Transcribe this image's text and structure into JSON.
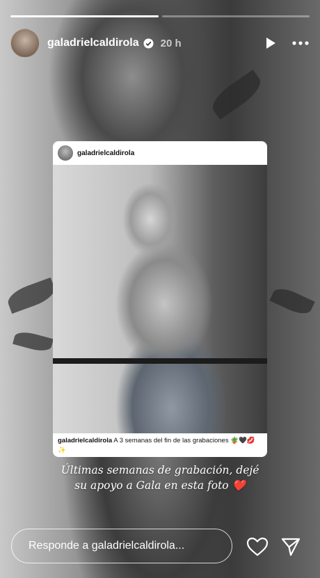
{
  "progress": {
    "segments": 2,
    "active_index": 0
  },
  "header": {
    "username": "galadrielcaldirola",
    "time": "20 h",
    "verified_icon": "verified-badge-icon",
    "play_icon": "play-icon",
    "more_icon": "more-icon"
  },
  "repost": {
    "username": "galadrielcaldirola",
    "caption_user": "galadrielcaldirola",
    "caption_text": "A 3 semanas del fin de las grabaciones 🪴🖤💋✨"
  },
  "story_text": {
    "line1": "Últimas semanas de grabación, dejé",
    "line2": "su apoyo a Gala en esta foto ❤️"
  },
  "footer": {
    "reply_placeholder": "Responde a galadrielcaldirola...",
    "like_icon": "heart-icon",
    "send_icon": "send-icon"
  }
}
